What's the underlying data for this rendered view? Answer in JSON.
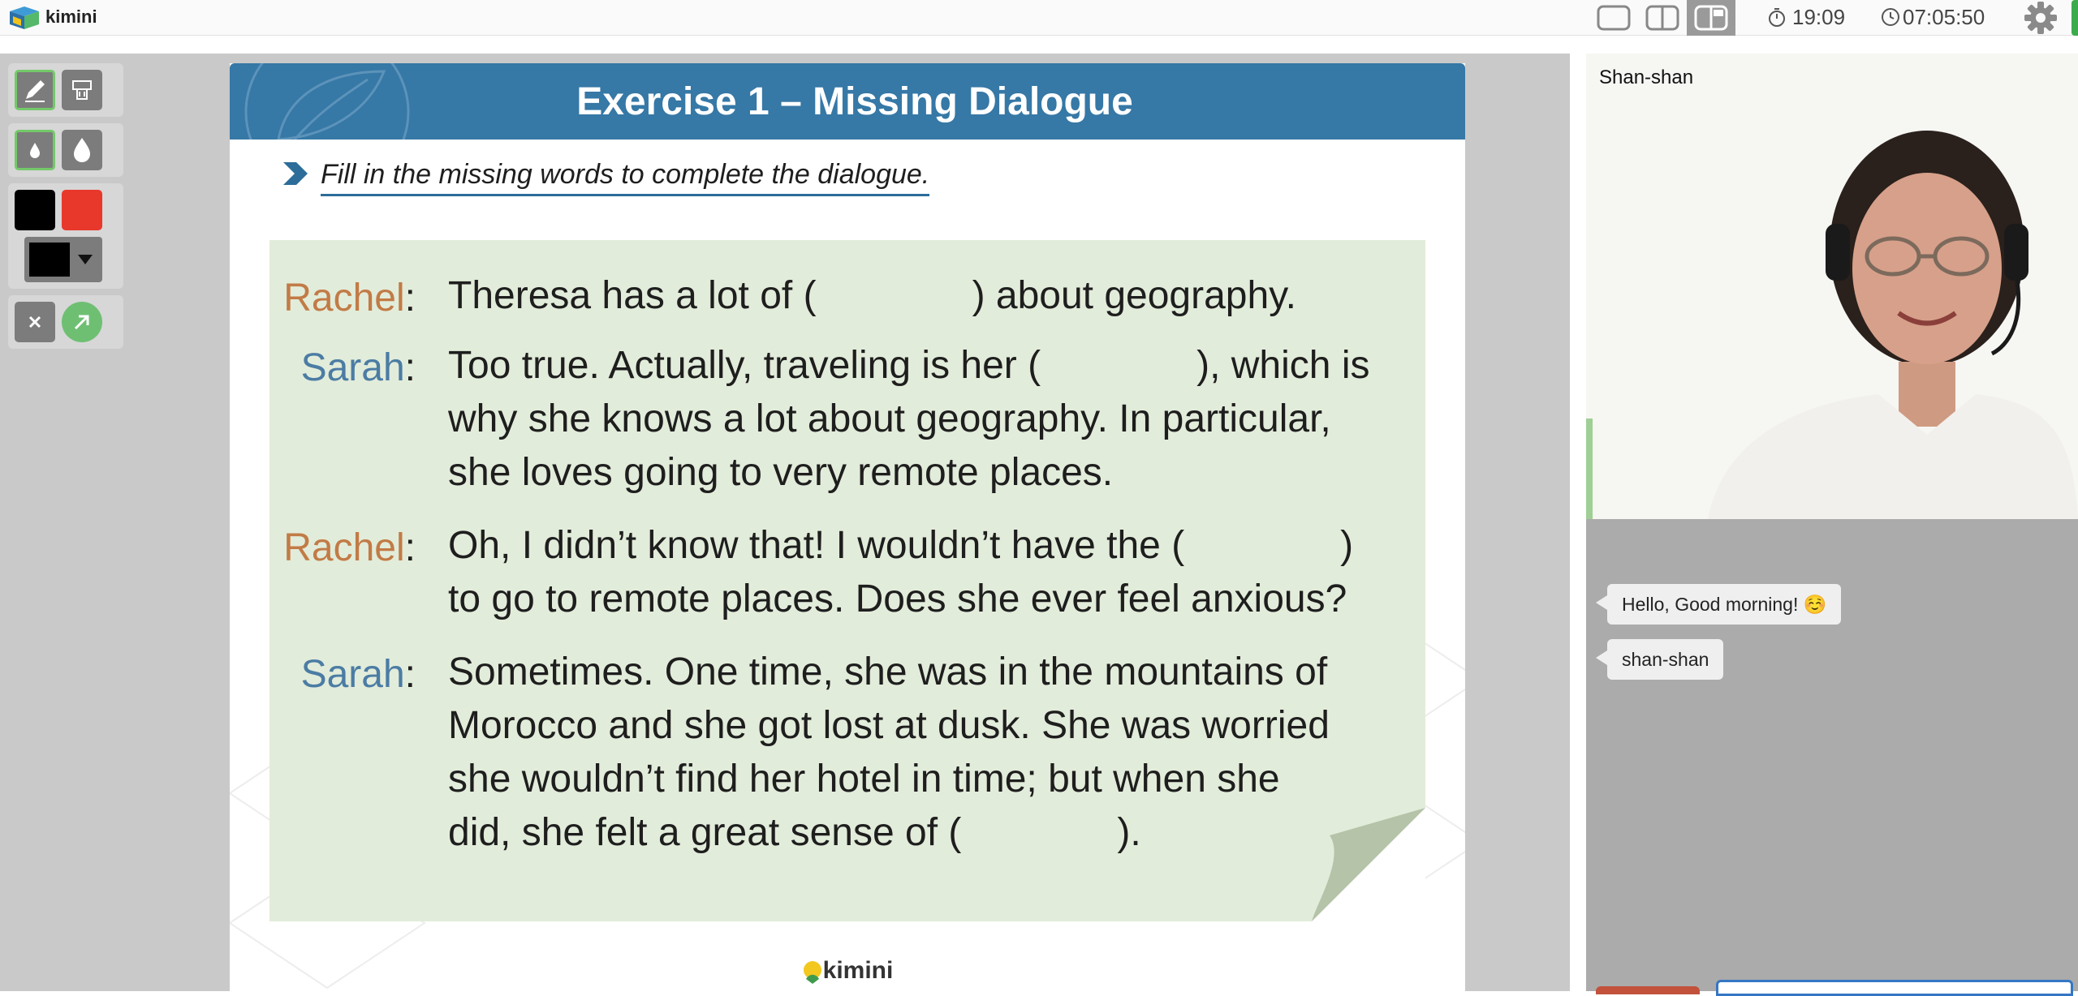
{
  "app": {
    "brand": "kimini"
  },
  "header": {
    "layout_buttons": [
      "single-layout",
      "split-layout",
      "sidebar-layout"
    ],
    "elapsed_time": "19:09",
    "clock_time": "07:05:50"
  },
  "toolbar": {
    "tools": [
      "pen",
      "eraser",
      "thin-drop",
      "thick-drop",
      "black-color",
      "red-color",
      "color-picker",
      "clear",
      "pointer"
    ],
    "colors": {
      "black": "#000000",
      "red": "#e8382c",
      "selected": "#000000",
      "accent": "#74c96a"
    }
  },
  "slide": {
    "title": "Exercise 1 – Missing Dialogue",
    "instruction": "Fill in the missing words to complete the dialogue.",
    "lines": [
      {
        "speaker": "Rachel",
        "lines": [
          "Theresa has a lot of (    ) about geography."
        ]
      },
      {
        "speaker": "Sarah",
        "lines": [
          "Too true. Actually, traveling is her (    ), which is",
          "why she knows a lot about geography. In particular,",
          "she loves going to very remote places."
        ]
      },
      {
        "speaker": "Rachel",
        "lines": [
          "Oh, I didn’t know that! I wouldn’t have the (    )",
          "to go to remote places. Does she ever feel anxious?"
        ]
      },
      {
        "speaker": "Sarah",
        "lines": [
          "Sometimes. One time, she was in the mountains of",
          "Morocco and she got lost at dusk. She was worried",
          "she wouldn’t find her hotel in time; but when she",
          "did, she felt a great sense of (    )."
        ]
      }
    ],
    "footer_logo": "kimini",
    "colors": {
      "header": "#3678a6",
      "card": "#e2ecda",
      "rachel": "#c27b46",
      "sarah": "#4b7ca4"
    }
  },
  "video": {
    "participant_name": "Shan-shan"
  },
  "chat": {
    "messages": [
      "Hello, Good morning! ☺️",
      "shan-shan"
    ]
  }
}
